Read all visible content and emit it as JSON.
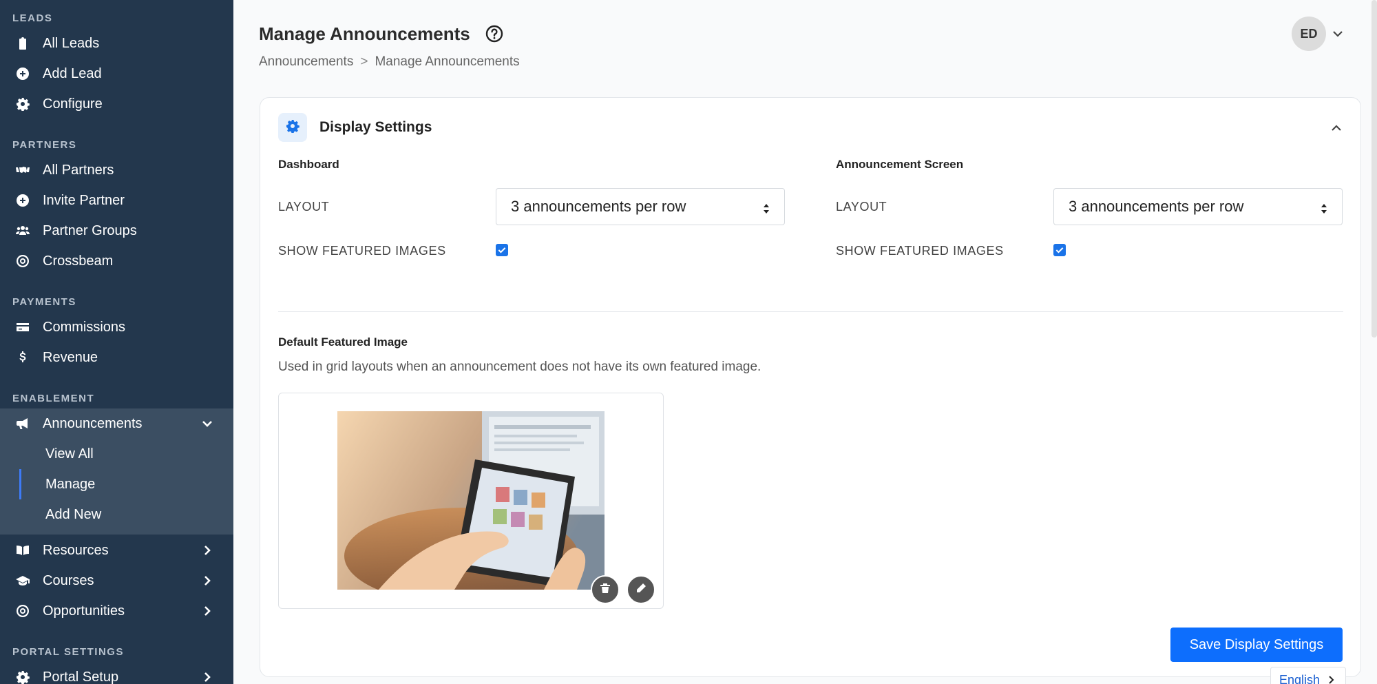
{
  "sidebar": {
    "sections": [
      {
        "title": "LEADS",
        "items": [
          "All Leads",
          "Add Lead",
          "Configure"
        ]
      },
      {
        "title": "PARTNERS",
        "items": [
          "All Partners",
          "Invite Partner",
          "Partner Groups",
          "Crossbeam"
        ]
      },
      {
        "title": "PAYMENTS",
        "items": [
          "Commissions",
          "Revenue"
        ]
      },
      {
        "title": "ENABLEMENT",
        "items": [
          "Announcements",
          "Resources",
          "Courses",
          "Opportunities"
        ]
      },
      {
        "title": "PORTAL SETTINGS",
        "items": [
          "Portal Setup"
        ]
      }
    ],
    "announcements_sub": [
      "View All",
      "Manage",
      "Add New"
    ],
    "active_sub": "Manage"
  },
  "header": {
    "title": "Manage Announcements",
    "breadcrumb": [
      "Announcements",
      ">",
      "Manage Announcements"
    ],
    "avatar_initials": "ED"
  },
  "card": {
    "title": "Display Settings",
    "dashboard": {
      "title": "Dashboard",
      "layout_label": "LAYOUT",
      "layout_value": "3 announcements per row",
      "featured_label": "SHOW FEATURED IMAGES",
      "featured_checked": true
    },
    "announcement_screen": {
      "title": "Announcement Screen",
      "layout_label": "LAYOUT",
      "layout_value": "3 announcements per row",
      "featured_label": "SHOW FEATURED IMAGES",
      "featured_checked": true
    },
    "default_image": {
      "title": "Default Featured Image",
      "description": "Used in grid layouts when an announcement does not have its own featured image."
    },
    "save_label": "Save Display Settings"
  },
  "language": "English",
  "colors": {
    "sidebar_bg": "#23374d",
    "sidebar_sub_bg": "#3b4e62",
    "accent": "#0d6efd"
  }
}
